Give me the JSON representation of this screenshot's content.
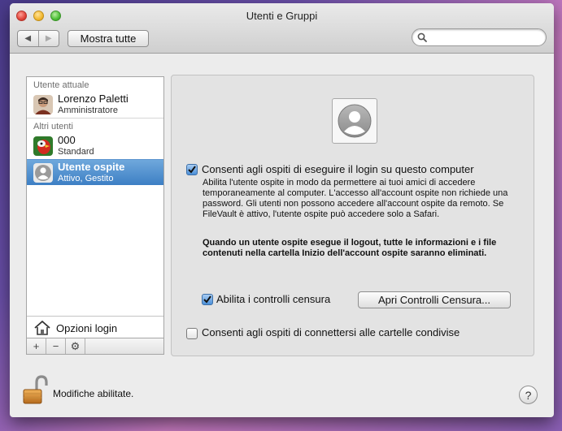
{
  "window": {
    "title": "Utenti e Gruppi"
  },
  "toolbar": {
    "back": "◀",
    "forward": "▶",
    "show_all": "Mostra tutte",
    "search_placeholder": ""
  },
  "sidebar": {
    "current_header": "Utente attuale",
    "current_user": {
      "name": "Lorenzo Paletti",
      "role": "Amministratore"
    },
    "others_header": "Altri utenti",
    "others": [
      {
        "name": "000",
        "role": "Standard"
      },
      {
        "name": "Utente ospite",
        "role": "Attivo, Gestito",
        "selected": true
      }
    ],
    "login_options": "Opzioni login",
    "tools": {
      "add": "+",
      "remove": "−",
      "action": "⚙"
    }
  },
  "main": {
    "allow_login": {
      "label": "Consenti agli ospiti di eseguire il login su questo computer",
      "checked": true
    },
    "description": "Abilita l'utente ospite in modo da permettere ai tuoi amici di accedere temporaneamente al computer. L'accesso all'account ospite non richiede una password. Gli utenti non possono accedere all'account ospite da remoto. Se FileVault è attivo, l'utente ospite può accedere solo a Safari.",
    "warning": "Quando un utente ospite esegue il logout, tutte le informazioni e i file contenuti nella cartella Inizio dell'account ospite saranno eliminati.",
    "parental": {
      "label": "Abilita i controlli censura",
      "checked": true,
      "button": "Apri Controlli Censura..."
    },
    "shared_folders": {
      "label": "Consenti agli ospiti di connettersi alle cartelle condivise",
      "checked": false
    }
  },
  "footer": {
    "lock_text": "Modifiche abilitate.",
    "help": "?"
  },
  "colors": {
    "selection": "#3d7fc4",
    "checkbox_checked": "#4a8fd8"
  }
}
